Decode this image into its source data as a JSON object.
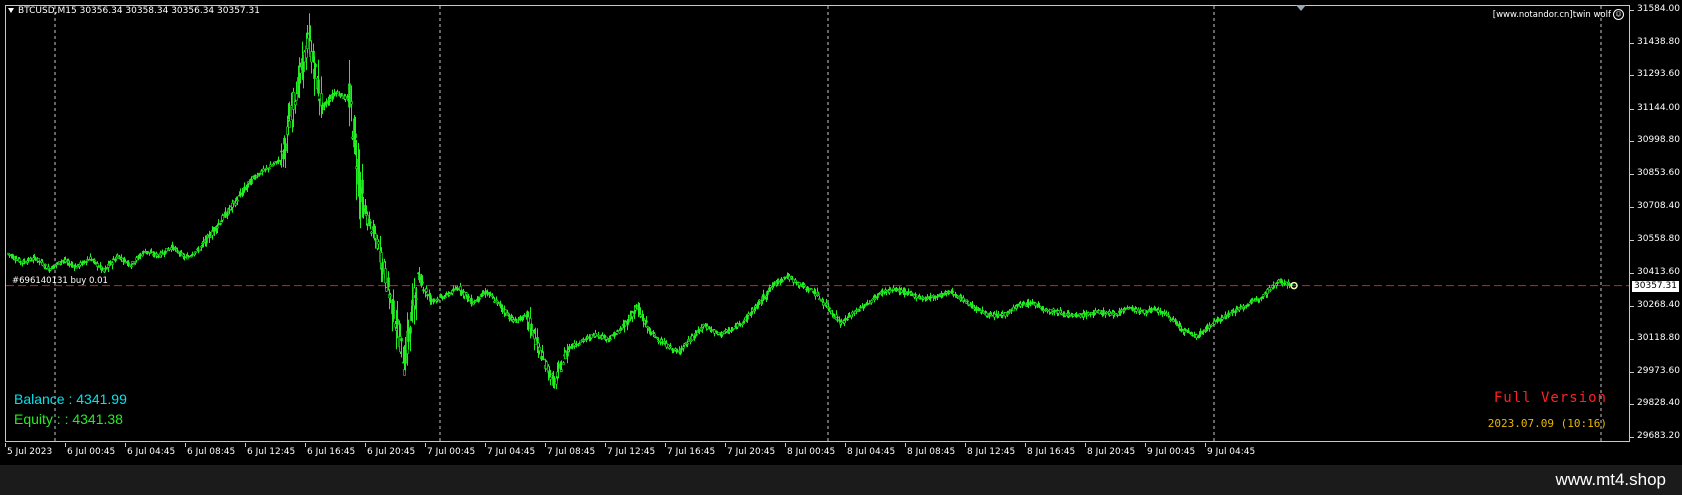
{
  "chart": {
    "symbol_line": "BTCUSD,M15  30356.34 30358.34 30356.34 30357.31",
    "watermark": "[www.notandor.cn]twin wolf",
    "order_label": "#696140131 buy 0.01",
    "balance_label": "Balance :  4341.99",
    "equity_label": "Equity :  : 4341.38",
    "full_version": "Full Version",
    "version_date": "2023.07.09 (10:16)",
    "current_price": "30357.31",
    "colors": {
      "candle": "#22ee22",
      "order_line": "#cc2222",
      "grid": "#c8c8c8",
      "balance": "#00e5ee",
      "equity": "#22ee22",
      "full_version": "#ff2020",
      "version_date": "#e6b800"
    },
    "price_scale": [
      "31584.00",
      "31438.80",
      "31293.60",
      "31144.00",
      "30998.80",
      "30853.60",
      "30708.40",
      "30558.80",
      "30413.60",
      "30268.40",
      "30118.80",
      "29973.60",
      "29828.40",
      "29683.20"
    ],
    "time_scale": [
      "5 Jul 2023",
      "6 Jul 00:45",
      "6 Jul 04:45",
      "6 Jul 08:45",
      "6 Jul 12:45",
      "6 Jul 16:45",
      "6 Jul 20:45",
      "7 Jul 00:45",
      "7 Jul 04:45",
      "7 Jul 08:45",
      "7 Jul 12:45",
      "7 Jul 16:45",
      "7 Jul 20:45",
      "8 Jul 00:45",
      "8 Jul 04:45",
      "8 Jul 08:45",
      "8 Jul 12:45",
      "8 Jul 16:45",
      "8 Jul 20:45",
      "9 Jul 00:45",
      "9 Jul 04:45"
    ]
  },
  "footer": {
    "site": "www.mt4.shop"
  },
  "chart_data": {
    "type": "candlestick",
    "title": "BTCUSD,M15",
    "y_range": [
      29683.2,
      31584.0
    ],
    "x_labels": [
      "5 Jul 2023",
      "6 Jul 00:45",
      "6 Jul 04:45",
      "6 Jul 08:45",
      "6 Jul 12:45",
      "6 Jul 16:45",
      "6 Jul 20:45",
      "7 Jul 00:45",
      "7 Jul 04:45",
      "7 Jul 08:45",
      "7 Jul 12:45",
      "7 Jul 16:45",
      "7 Jul 20:45",
      "8 Jul 00:45",
      "8 Jul 04:45",
      "8 Jul 08:45",
      "8 Jul 12:45",
      "8 Jul 16:45",
      "8 Jul 20:45",
      "9 Jul 00:45",
      "9 Jul 04:45"
    ],
    "close_path": [
      [
        0,
        30500
      ],
      [
        1,
        30460
      ],
      [
        2,
        30480
      ],
      [
        3,
        30430
      ],
      [
        4,
        30470
      ],
      [
        5,
        30440
      ],
      [
        6,
        30480
      ],
      [
        7,
        30420
      ],
      [
        8,
        30490
      ],
      [
        9,
        30450
      ],
      [
        10,
        30510
      ],
      [
        11,
        30490
      ],
      [
        12,
        30530
      ],
      [
        13,
        30480
      ],
      [
        14,
        30520
      ],
      [
        15,
        30600
      ],
      [
        16,
        30680
      ],
      [
        17,
        30760
      ],
      [
        18,
        30840
      ],
      [
        19,
        30880
      ],
      [
        20,
        30920
      ],
      [
        21,
        31200
      ],
      [
        22,
        31450
      ],
      [
        23,
        31150
      ],
      [
        24,
        31220
      ],
      [
        25,
        31180
      ],
      [
        26,
        30700
      ],
      [
        27,
        30550
      ],
      [
        28,
        30300
      ],
      [
        29,
        30020
      ],
      [
        30,
        30400
      ],
      [
        31,
        30290
      ],
      [
        32,
        30310
      ],
      [
        33,
        30350
      ],
      [
        34,
        30280
      ],
      [
        35,
        30330
      ],
      [
        36,
        30270
      ],
      [
        37,
        30200
      ],
      [
        38,
        30220
      ],
      [
        39,
        30050
      ],
      [
        40,
        29920
      ],
      [
        41,
        30080
      ],
      [
        42,
        30110
      ],
      [
        43,
        30140
      ],
      [
        44,
        30120
      ],
      [
        45,
        30170
      ],
      [
        46,
        30260
      ],
      [
        47,
        30150
      ],
      [
        48,
        30100
      ],
      [
        49,
        30060
      ],
      [
        50,
        30120
      ],
      [
        51,
        30180
      ],
      [
        52,
        30140
      ],
      [
        53,
        30160
      ],
      [
        54,
        30210
      ],
      [
        55,
        30280
      ],
      [
        56,
        30360
      ],
      [
        57,
        30400
      ],
      [
        58,
        30360
      ],
      [
        59,
        30330
      ],
      [
        60,
        30260
      ],
      [
        61,
        30190
      ],
      [
        62,
        30240
      ],
      [
        63,
        30280
      ],
      [
        64,
        30330
      ],
      [
        65,
        30340
      ],
      [
        66,
        30320
      ],
      [
        67,
        30300
      ],
      [
        68,
        30310
      ],
      [
        69,
        30330
      ],
      [
        70,
        30290
      ],
      [
        71,
        30250
      ],
      [
        72,
        30220
      ],
      [
        73,
        30230
      ],
      [
        74,
        30270
      ],
      [
        75,
        30280
      ],
      [
        76,
        30250
      ],
      [
        77,
        30240
      ],
      [
        78,
        30220
      ],
      [
        79,
        30230
      ],
      [
        80,
        30240
      ],
      [
        81,
        30230
      ],
      [
        82,
        30260
      ],
      [
        83,
        30240
      ],
      [
        84,
        30250
      ],
      [
        85,
        30220
      ],
      [
        86,
        30160
      ],
      [
        87,
        30130
      ],
      [
        88,
        30180
      ],
      [
        89,
        30220
      ],
      [
        90,
        30250
      ],
      [
        91,
        30280
      ],
      [
        92,
        30320
      ],
      [
        93,
        30380
      ],
      [
        94,
        30357
      ]
    ]
  }
}
